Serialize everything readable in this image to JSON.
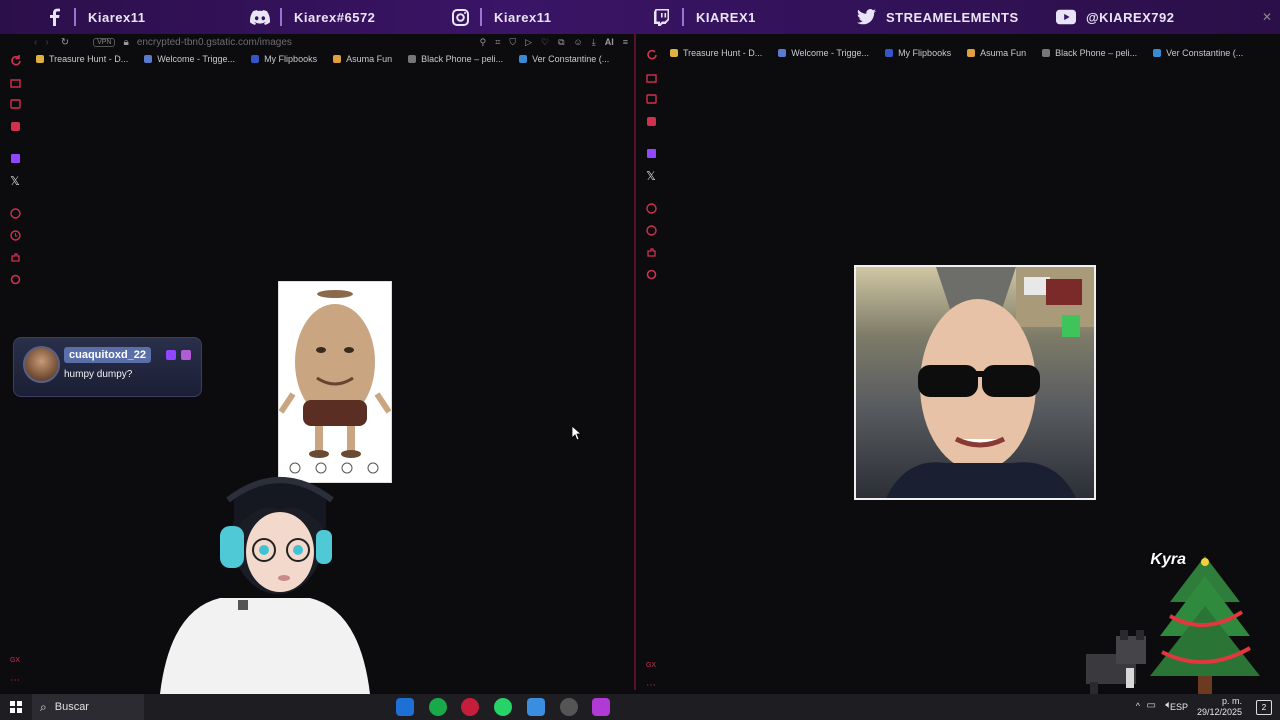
{
  "banner": {
    "items": [
      {
        "icon": "facebook-icon",
        "label": "Kiarex11"
      },
      {
        "icon": "discord-icon",
        "label": "Kiarex#6572"
      },
      {
        "icon": "instagram-icon",
        "label": "Kiarex11"
      },
      {
        "icon": "twitch-icon",
        "label": "KIAREX1"
      },
      {
        "icon": "twitter-icon",
        "label": "STREAMELEMENTS"
      },
      {
        "icon": "youtube-icon",
        "label": "@KIAREX792"
      }
    ]
  },
  "left_browser": {
    "url": "encrypted-tbn0.gstatic.com/images",
    "vpn_label": "VPN",
    "ai_label": "AI",
    "bookmarks": [
      "Treasure Hunt - D...",
      "Welcome - Trigge...",
      "My Flipbooks",
      "Asuma Fun",
      "Black Phone – peli...",
      "Ver Constantine (..."
    ]
  },
  "right_browser": {
    "bookmarks": [
      "Treasure Hunt - D...",
      "Welcome - Trigge...",
      "My Flipbooks",
      "Asuma Fun",
      "Black Phone – peli...",
      "Ver Constantine (..."
    ]
  },
  "chat": {
    "username": "cuaquitoxd_22",
    "message": "humpy dumpy?"
  },
  "overlay": {
    "sticker_text": "Kyra"
  },
  "taskbar": {
    "search_label": "Buscar",
    "language": "ESP",
    "time": "p. m.",
    "date": "29/12/2025",
    "notification_count": "2"
  },
  "colors": {
    "banner_bg": "#3a1466",
    "banner_accent": "#6c2fbf",
    "pane_divider": "#5a0f2a",
    "sidebar_icon": "#d1304f",
    "chat_bg": "#1b1f35"
  }
}
